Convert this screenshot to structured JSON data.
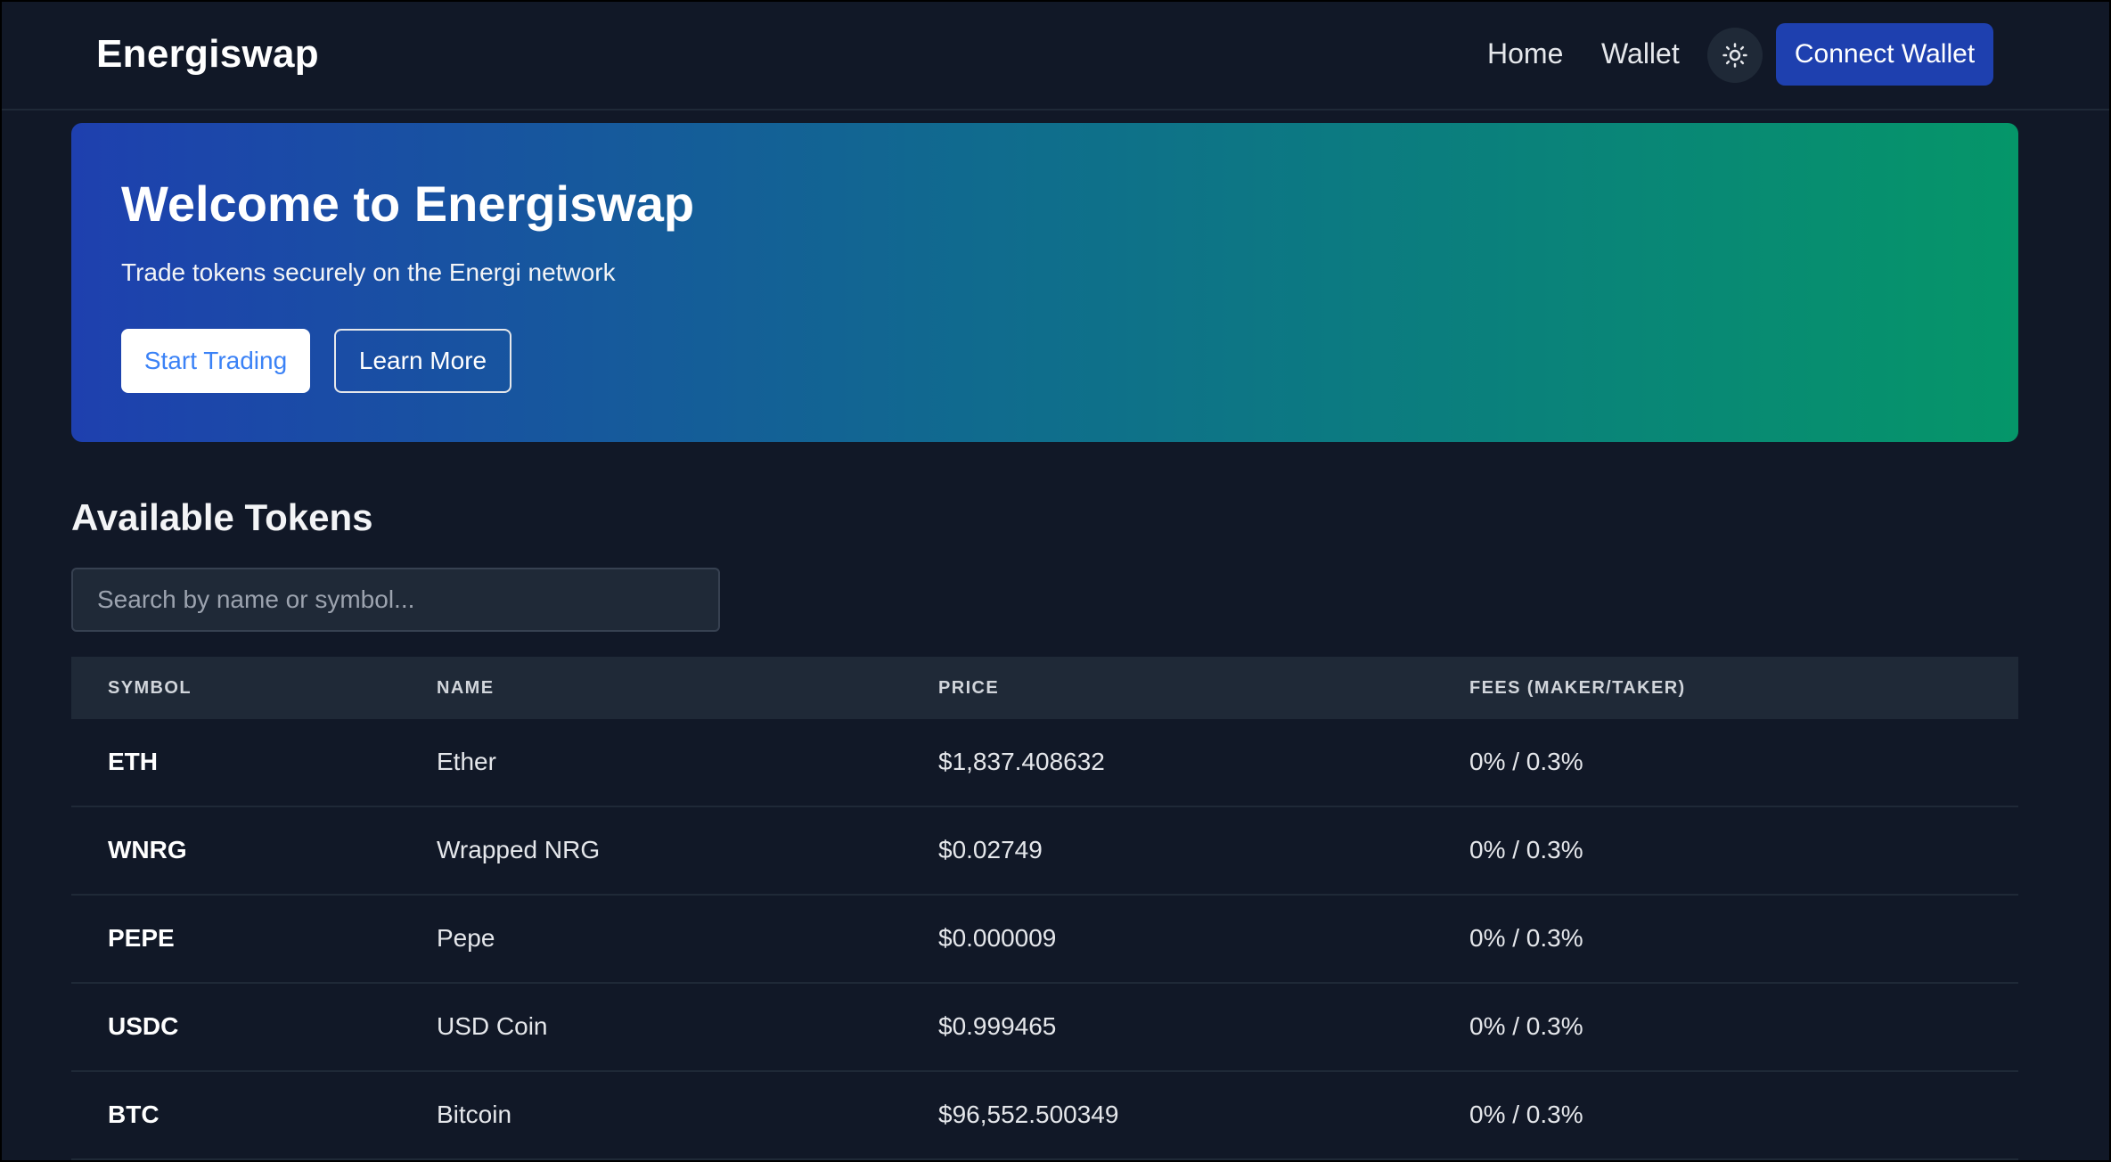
{
  "header": {
    "logo": "Energiswap",
    "nav": {
      "home": "Home",
      "wallet": "Wallet"
    },
    "theme_icon": "sun-icon",
    "connect_label": "Connect Wallet"
  },
  "hero": {
    "title": "Welcome to Energiswap",
    "subtitle": "Trade tokens securely on the Energi network",
    "start_label": "Start Trading",
    "learn_label": "Learn More"
  },
  "tokens": {
    "title": "Available Tokens",
    "search_placeholder": "Search by name or symbol...",
    "columns": [
      "SYMBOL",
      "NAME",
      "PRICE",
      "FEES (MAKER/TAKER)"
    ],
    "rows": [
      {
        "symbol": "ETH",
        "name": "Ether",
        "price": "$1,837.408632",
        "fees": "0% / 0.3%"
      },
      {
        "symbol": "WNRG",
        "name": "Wrapped NRG",
        "price": "$0.02749",
        "fees": "0% / 0.3%"
      },
      {
        "symbol": "PEPE",
        "name": "Pepe",
        "price": "$0.000009",
        "fees": "0% / 0.3%"
      },
      {
        "symbol": "USDC",
        "name": "USD Coin",
        "price": "$0.999465",
        "fees": "0% / 0.3%"
      },
      {
        "symbol": "BTC",
        "name": "Bitcoin",
        "price": "$96,552.500349",
        "fees": "0% / 0.3%"
      }
    ]
  },
  "colors": {
    "background": "#111827",
    "accent": "#1e40af",
    "gradient_start": "#1e40af",
    "gradient_end": "#059669"
  }
}
